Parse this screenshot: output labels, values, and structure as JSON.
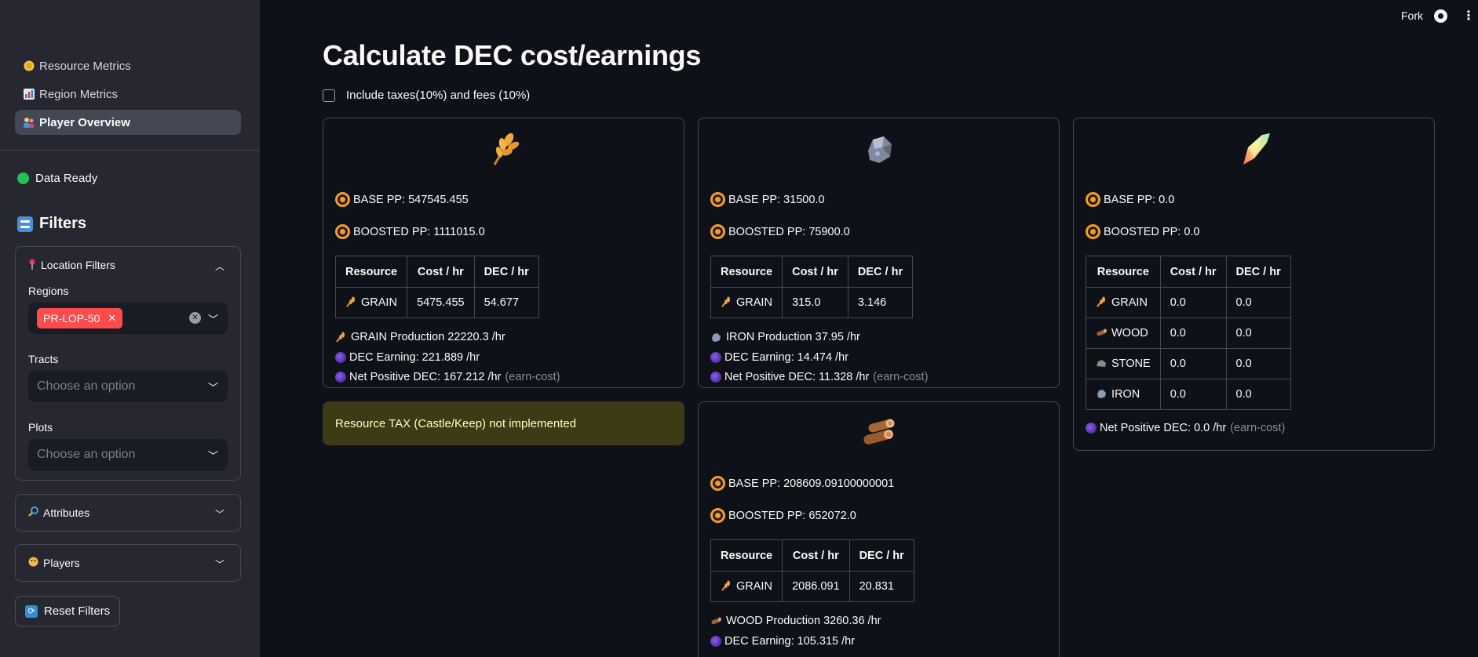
{
  "sidebar": {
    "nav": [
      {
        "label": "Resource Metrics",
        "icon": "coin-icon"
      },
      {
        "label": "Region Metrics",
        "icon": "bar-chart-icon"
      },
      {
        "label": "Player Overview",
        "icon": "people-icon"
      }
    ],
    "status": "Data Ready",
    "filters_title": "Filters",
    "location_filters": {
      "title": "Location Filters",
      "regions_label": "Regions",
      "region_tag": "PR-LOP-50",
      "tracts_label": "Tracts",
      "tracts_placeholder": "Choose an option",
      "plots_label": "Plots",
      "plots_placeholder": "Choose an option"
    },
    "attributes_label": "Attributes",
    "players_label": "Players",
    "reset_label": "Reset Filters"
  },
  "header": {
    "fork": "Fork"
  },
  "main": {
    "title": "Calculate DEC cost/earnings",
    "checkbox_label": "Include taxes(10%) and fees (10%)",
    "table_headers": [
      "Resource",
      "Cost / hr",
      "DEC / hr"
    ],
    "warning": "Resource TAX (Castle/Keep) not implemented",
    "cards": {
      "grain": {
        "base_pp": "BASE PP: 547545.455",
        "boosted_pp": "BOOSTED PP: 1111015.0",
        "rows": [
          {
            "resource": "GRAIN",
            "cost": "5475.455",
            "dec": "54.677"
          }
        ],
        "production": "GRAIN Production 22220.3 /hr",
        "dec_earning": "DEC Earning: 221.889 /hr",
        "net": "Net Positive DEC: 167.212 /hr",
        "net_note": "(earn-cost)"
      },
      "iron": {
        "base_pp": "BASE PP: 31500.0",
        "boosted_pp": "BOOSTED PP: 75900.0",
        "rows": [
          {
            "resource": "GRAIN",
            "cost": "315.0",
            "dec": "3.146"
          }
        ],
        "production": "IRON Production 37.95 /hr",
        "dec_earning": "DEC Earning: 14.474 /hr",
        "net": "Net Positive DEC: 11.328 /hr",
        "net_note": "(earn-cost)"
      },
      "research": {
        "base_pp": "BASE PP: 0.0",
        "boosted_pp": "BOOSTED PP: 0.0",
        "rows": [
          {
            "resource": "GRAIN",
            "cost": "0.0",
            "dec": "0.0"
          },
          {
            "resource": "WOOD",
            "cost": "0.0",
            "dec": "0.0"
          },
          {
            "resource": "STONE",
            "cost": "0.0",
            "dec": "0.0"
          },
          {
            "resource": "IRON",
            "cost": "0.0",
            "dec": "0.0"
          }
        ],
        "net": "Net Positive DEC: 0.0 /hr",
        "net_note": "(earn-cost)"
      },
      "wood": {
        "base_pp": "BASE PP: 208609.09100000001",
        "boosted_pp": "BOOSTED PP: 652072.0",
        "rows": [
          {
            "resource": "GRAIN",
            "cost": "2086.091",
            "dec": "20.831"
          }
        ],
        "production": "WOOD Production 3260.36 /hr",
        "dec_earning": "DEC Earning: 105.315 /hr"
      }
    }
  }
}
